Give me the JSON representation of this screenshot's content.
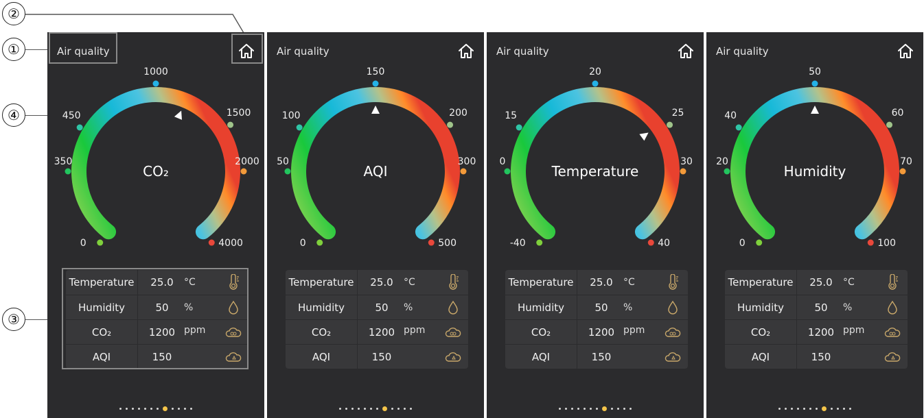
{
  "callouts": [
    "①",
    "②",
    "③",
    "④"
  ],
  "panels": [
    {
      "title": "Air quality",
      "center_label": "CO₂",
      "ticks": [
        "0",
        "350",
        "450",
        "1000",
        "1500",
        "2000",
        "4000"
      ],
      "pointer_fraction": 0.58,
      "page_dots": 12,
      "active_dot": 7
    },
    {
      "title": "Air quality",
      "center_label": "AQI",
      "ticks": [
        "0",
        "50",
        "100",
        "150",
        "200",
        "300",
        "500"
      ],
      "pointer_fraction": 0.5,
      "page_dots": 12,
      "active_dot": 7
    },
    {
      "title": "Air quality",
      "center_label": "Temperature",
      "ticks": [
        "-40",
        "0",
        "15",
        "20",
        "25",
        "30",
        "40"
      ],
      "pointer_fraction": 0.69,
      "page_dots": 12,
      "active_dot": 7
    },
    {
      "title": "Air quality",
      "center_label": "Humidity",
      "ticks": [
        "0",
        "20",
        "40",
        "50",
        "60",
        "70",
        "100"
      ],
      "pointer_fraction": 0.5,
      "page_dots": 12,
      "active_dot": 7
    }
  ],
  "readings": [
    {
      "name": "Temperature",
      "value": "25.0",
      "unit": "°C",
      "icon": "thermometer-icon"
    },
    {
      "name": "Humidity",
      "value": "50",
      "unit": "%",
      "icon": "droplet-icon"
    },
    {
      "name": "CO₂",
      "value": "1200",
      "unit": "ppm",
      "icon": "co2-cloud-icon"
    },
    {
      "name": "AQI",
      "value": "150",
      "unit": "",
      "icon": "aqi-cloud-icon"
    }
  ],
  "colors": {
    "panel_bg": "#2b2b2d",
    "table_bg": "#38383a",
    "accent_dot": "#f5c54a",
    "icon_gold": "#c9a86a"
  }
}
